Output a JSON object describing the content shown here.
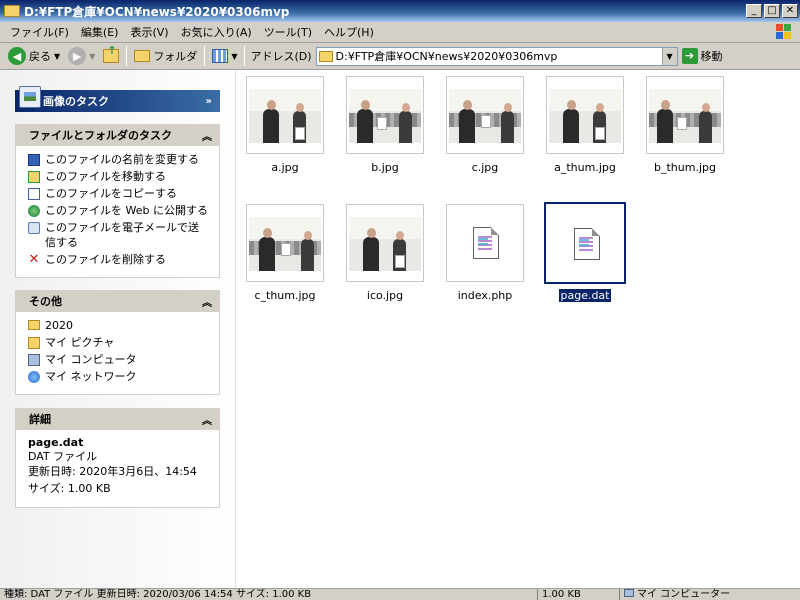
{
  "window": {
    "title": "D:¥FTP倉庫¥OCN¥news¥2020¥0306mvp",
    "min": "_",
    "max": "□",
    "close": "✕"
  },
  "menu": [
    "ファイル(F)",
    "編集(E)",
    "表示(V)",
    "お気に入り(A)",
    "ツール(T)",
    "ヘルプ(H)"
  ],
  "toolbar": {
    "back_label": "戻る",
    "forward_label": "",
    "folder_label": "フォルダ",
    "address_label": "アドレス(D)",
    "address_value": "D:¥FTP倉庫¥OCN¥news¥2020¥0306mvp",
    "go_label": "移動"
  },
  "tasks": {
    "image_tasks_title": "画像のタスク",
    "file_tasks_title": "ファイルとフォルダのタスク",
    "file_tasks": [
      {
        "label": "このファイルの名前を変更する",
        "icon": "rename-icon"
      },
      {
        "label": "このファイルを移動する",
        "icon": "move-icon"
      },
      {
        "label": "このファイルをコピーする",
        "icon": "copy-icon"
      },
      {
        "label": "このファイルを Web に公開する",
        "icon": "web-publish-icon"
      },
      {
        "label": "このファイルを電子メールで送信する",
        "icon": "email-icon"
      },
      {
        "label": "このファイルを削除する",
        "icon": "delete-icon"
      }
    ],
    "other_title": "その他",
    "other": [
      {
        "label": "2020",
        "icon": "folder-icon"
      },
      {
        "label": "マイ ピクチャ",
        "icon": "my-pictures-icon"
      },
      {
        "label": "マイ コンピュータ",
        "icon": "my-computer-icon"
      },
      {
        "label": "マイ ネットワーク",
        "icon": "network-icon"
      }
    ],
    "details_title": "詳細",
    "details": {
      "name": "page.dat",
      "type": "DAT ファイル",
      "modified": "更新日時: 2020年3月6日、14:54",
      "size": "サイズ: 1.00 KB"
    }
  },
  "files": [
    {
      "name": "a.jpg",
      "kind": "photo-portrait"
    },
    {
      "name": "b.jpg",
      "kind": "photo-handover"
    },
    {
      "name": "c.jpg",
      "kind": "photo-handover"
    },
    {
      "name": "a_thum.jpg",
      "kind": "photo-portrait"
    },
    {
      "name": "b_thum.jpg",
      "kind": "photo-handover"
    },
    {
      "name": "c_thum.jpg",
      "kind": "photo-handover"
    },
    {
      "name": "ico.jpg",
      "kind": "photo-portrait"
    },
    {
      "name": "index.php",
      "kind": "document"
    },
    {
      "name": "page.dat",
      "kind": "document",
      "selected": true
    }
  ],
  "statusbar": {
    "info": "種類: DAT ファイル 更新日時: 2020/03/06 14:54 サイズ: 1.00 KB",
    "size": "1.00 KB",
    "location": "マイ コンピューター"
  }
}
